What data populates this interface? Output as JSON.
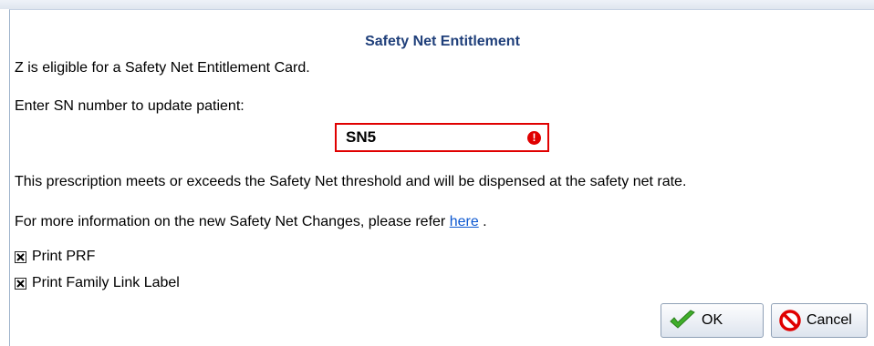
{
  "dialog": {
    "title": "Safety Net Entitlement",
    "eligibility_text": "Z is eligible for a Safety Net Entitlement Card.",
    "sn_prompt": "Enter SN number to update patient:",
    "sn_value": "SN5",
    "threshold_text": "This prescription meets or exceeds the Safety Net threshold and will be dispensed at the safety net rate.",
    "info_prefix": "For more information on the new Safety Net Changes, please refer ",
    "info_link": "here",
    "info_suffix": " .",
    "print_prf_label": "Print PRF",
    "print_prf_checked": true,
    "print_family_label": "Print Family Link Label",
    "print_family_checked": true,
    "ok_label": "OK",
    "cancel_label": "Cancel",
    "error_color": "#e00000",
    "title_color": "#1f3f7a",
    "link_color": "#0b57d0"
  }
}
